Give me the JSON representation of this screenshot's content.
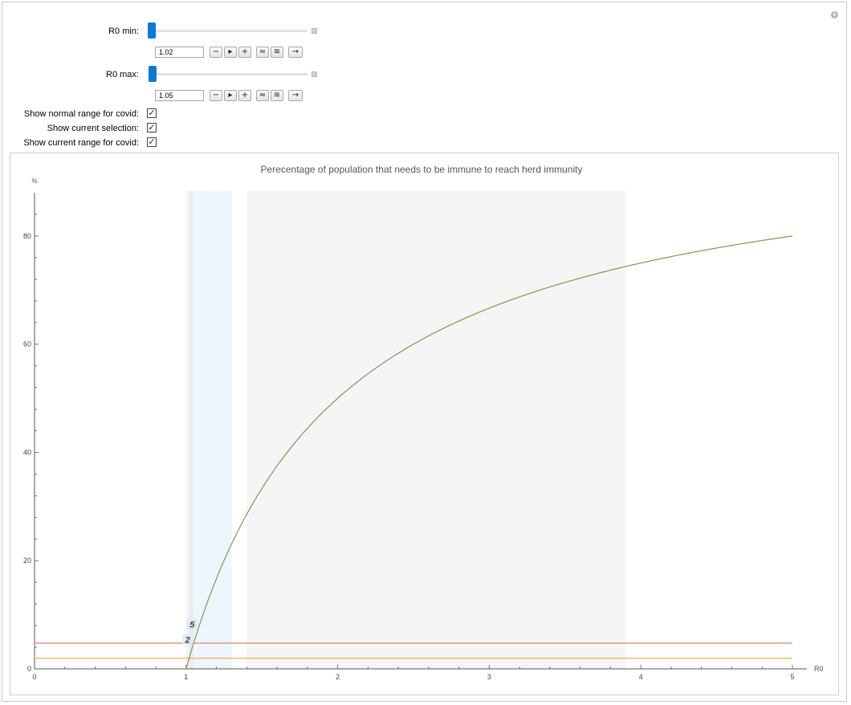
{
  "controls": {
    "r0_min": {
      "label": "R0 min:",
      "value": "1.02",
      "slider_fraction": 0.005
    },
    "r0_max": {
      "label": "R0 max:",
      "value": "1.05",
      "slider_fraction": 0.0125
    },
    "buttons": [
      "−",
      "▸",
      "+",
      "≈",
      "≋",
      "→"
    ],
    "checkboxes": [
      {
        "label": "Show normal range for covid:",
        "checked": true
      },
      {
        "label": "Show current selection:",
        "checked": true
      },
      {
        "label": "Show current range for covid:",
        "checked": true
      }
    ]
  },
  "chart_data": {
    "type": "line",
    "title": "Perecentage of population that needs to be immune to reach herd immunity",
    "xlabel": "R0",
    "ylabel": "%",
    "xlim": [
      0,
      5
    ],
    "ylim": [
      0,
      88
    ],
    "x_ticks": [
      0,
      1,
      2,
      3,
      4,
      5
    ],
    "y_ticks": [
      0,
      20,
      40,
      60,
      80
    ],
    "series": [
      {
        "function": "100*(1-1/x)",
        "x_range": [
          1,
          5
        ],
        "color": "#7a9a50"
      }
    ],
    "shaded_regions": [
      {
        "x_start": 1.0,
        "x_end": 1.3,
        "color": "#eef6fd"
      },
      {
        "x_start": 1.02,
        "x_end": 1.05,
        "color": "#ececec"
      },
      {
        "x_start": 1.4,
        "x_end": 3.9,
        "color": "#f5f5f5"
      }
    ],
    "hlines": [
      {
        "y": 4.76,
        "color": "#e08d78"
      },
      {
        "y": 1.96,
        "color": "#eab55a"
      }
    ],
    "annotations": [
      {
        "text": "5",
        "x": 1.04,
        "y": 7.8
      },
      {
        "text": "2",
        "x": 1.01,
        "y": 5.0
      }
    ]
  },
  "colors": {
    "accent": "#0a78d7"
  }
}
